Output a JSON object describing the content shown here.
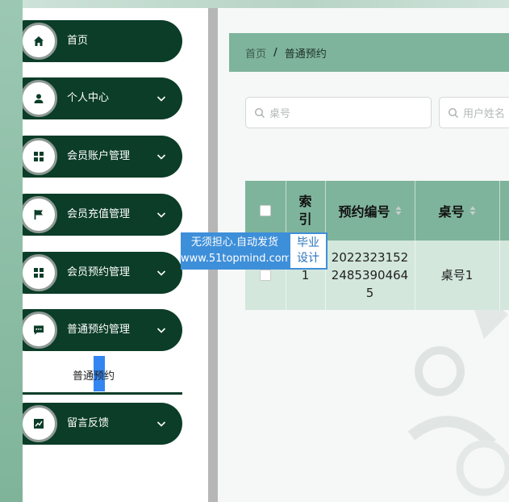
{
  "sidebar": {
    "items": [
      {
        "label": "首页",
        "icon": "home-icon",
        "has_chevron": false
      },
      {
        "label": "个人中心",
        "icon": "user-icon",
        "has_chevron": true
      },
      {
        "label": "会员账户管理",
        "icon": "grid-icon",
        "has_chevron": true
      },
      {
        "label": "会员充值管理",
        "icon": "flag-icon",
        "has_chevron": true
      },
      {
        "label": "会员预约管理",
        "icon": "grid-icon",
        "has_chevron": true
      },
      {
        "label": "普通预约管理",
        "icon": "chat-icon",
        "has_chevron": true
      },
      {
        "label": "留言反馈",
        "icon": "chart-icon",
        "has_chevron": true
      }
    ],
    "submenu": {
      "label": "普通预约"
    }
  },
  "breadcrumb": {
    "home": "首页",
    "separator": "/",
    "current": "普通预约"
  },
  "search": {
    "table_placeholder": "桌号",
    "user_placeholder": "用户姓名"
  },
  "table": {
    "headers": [
      "索引",
      "预约编号",
      "桌号"
    ],
    "rows": [
      {
        "index": "1",
        "booking_no": "202232315224853904645",
        "table_no": "桌号1"
      }
    ]
  },
  "watermark": {
    "line1": "无须担心.自动发货",
    "line2": "www.51topmind.com",
    "badge1": "毕业",
    "badge2": "设计"
  },
  "colors": {
    "sidebar_item_bg": "#0b3d28",
    "header_green": "#7fb49c",
    "row_green": "#d3e7dc",
    "watermark_blue": "#3e8fd9"
  }
}
